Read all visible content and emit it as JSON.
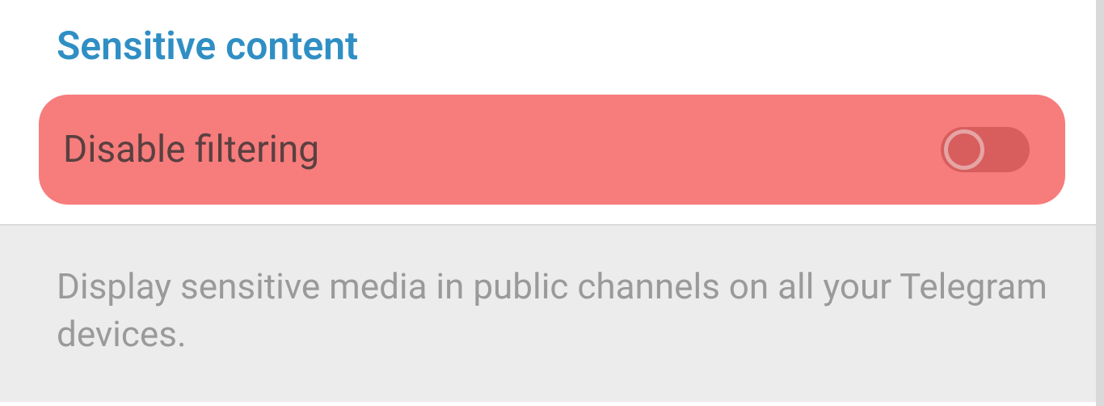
{
  "section": {
    "title": "Sensitive content"
  },
  "setting": {
    "label": "Disable filtering",
    "toggle_state": "off"
  },
  "description": {
    "text": "Display sensitive media in public channels on all your Telegram devices."
  }
}
